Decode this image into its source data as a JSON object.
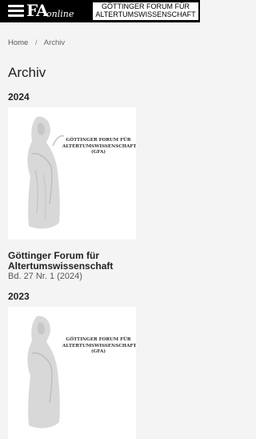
{
  "header": {
    "logo_main": "FA",
    "logo_sub": "online",
    "banner_line1": "GÖTTINGER FORUM FÜR",
    "banner_line2": "ALTERTUMSWISSENSCHAFT"
  },
  "breadcrumb": {
    "home": "Home",
    "separator": "/",
    "current": "Archiv"
  },
  "page_title": "Archiv",
  "sections": [
    {
      "year": "2024",
      "cover_text": [
        "GÖTTINGER FORUM FÜR",
        "ALTERTUMSWISSENSCHAFT",
        "(GFA)"
      ],
      "issue_title": "Göttinger Forum für Altertumswissenschaft",
      "issue_sub": "Bd. 27 Nr. 1 (2024)"
    },
    {
      "year": "2023",
      "cover_text": [
        "GÖTTINGER FORUM FÜR",
        "ALTERTUMSWISSENSCHAFT",
        "(GFA)"
      ]
    }
  ],
  "icons": {
    "menu": "hamburger-menu-icon"
  }
}
